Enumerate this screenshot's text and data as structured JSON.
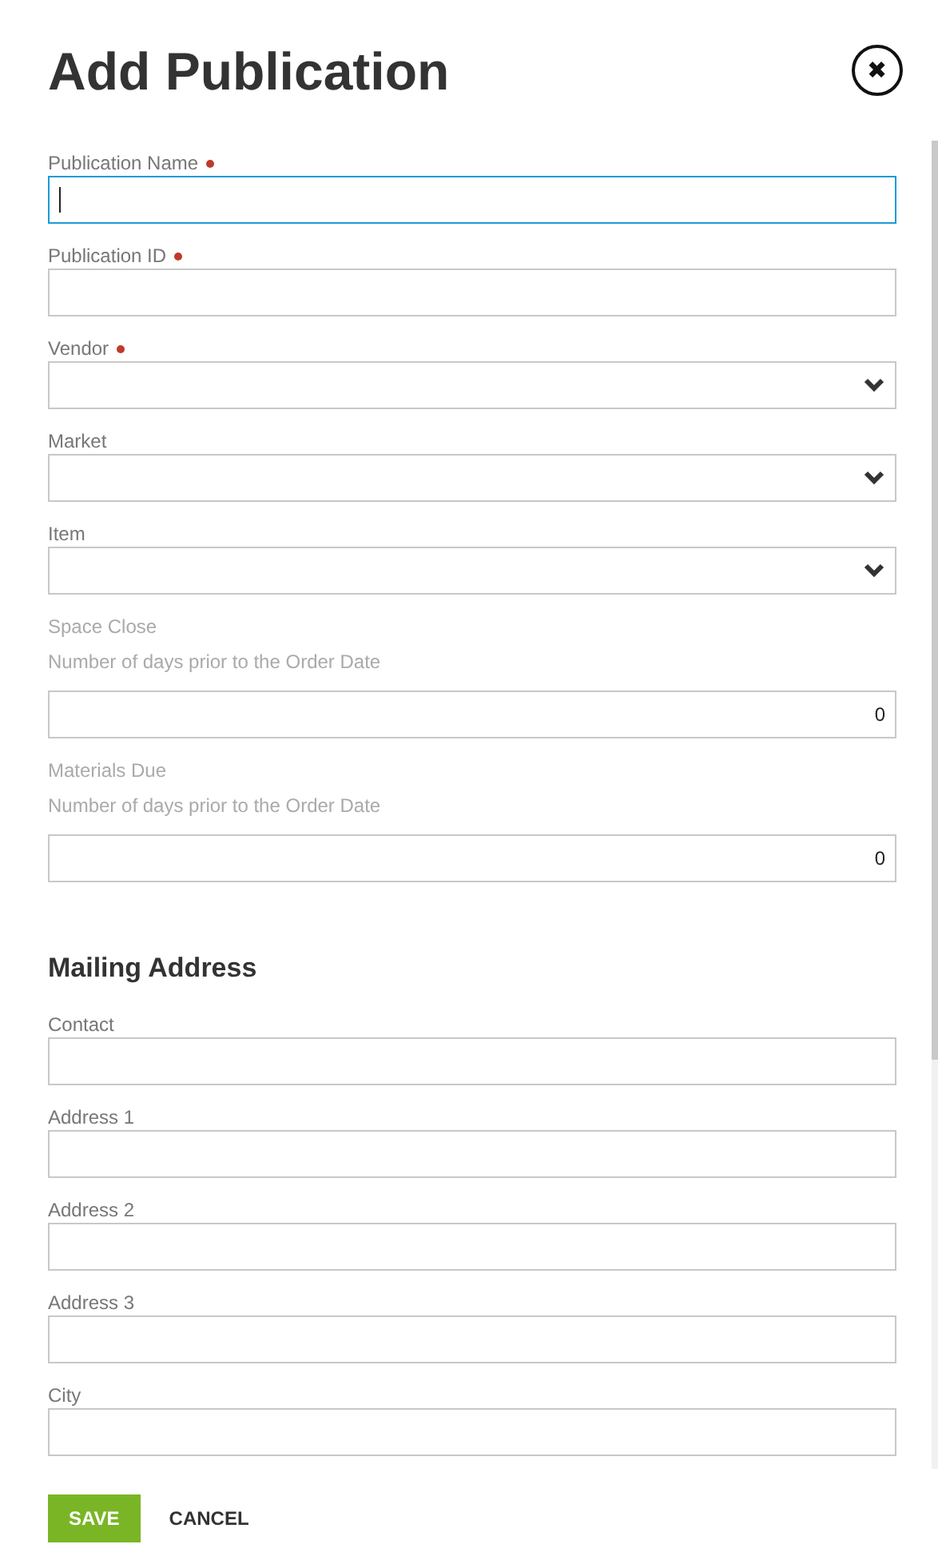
{
  "dialog": {
    "title": "Add Publication",
    "close_symbol": "✖"
  },
  "fields": [
    {
      "kind": "text",
      "label": "Publication Name",
      "required": true,
      "focused": true
    },
    {
      "kind": "text",
      "label": "Publication ID",
      "required": true,
      "focused": false
    },
    {
      "kind": "select",
      "label": "Vendor",
      "required": true,
      "focused": false
    },
    {
      "kind": "select",
      "label": "Market",
      "required": false,
      "focused": false
    },
    {
      "kind": "select",
      "label": "Item",
      "required": false,
      "focused": false
    },
    {
      "kind": "number",
      "label": "Space Close",
      "hint": "Number of days prior to the Order Date",
      "value": "0",
      "required": false,
      "focused": false
    },
    {
      "kind": "number",
      "label": "Materials Due",
      "hint": "Number of days prior to the Order Date",
      "value": "0",
      "required": false,
      "focused": false
    }
  ],
  "section": {
    "title": "Mailing Address",
    "fields": [
      {
        "kind": "text",
        "label": "Contact",
        "required": false,
        "focused": false
      },
      {
        "kind": "text",
        "label": "Address 1",
        "required": false,
        "focused": false
      },
      {
        "kind": "text",
        "label": "Address 2",
        "required": false,
        "focused": false
      },
      {
        "kind": "text",
        "label": "Address 3",
        "required": false,
        "focused": false
      },
      {
        "kind": "text",
        "label": "City",
        "required": false,
        "focused": false
      }
    ]
  },
  "buttons": [
    {
      "kind": "primary",
      "label": "SAVE"
    },
    {
      "kind": "link",
      "label": "CANCEL"
    }
  ]
}
